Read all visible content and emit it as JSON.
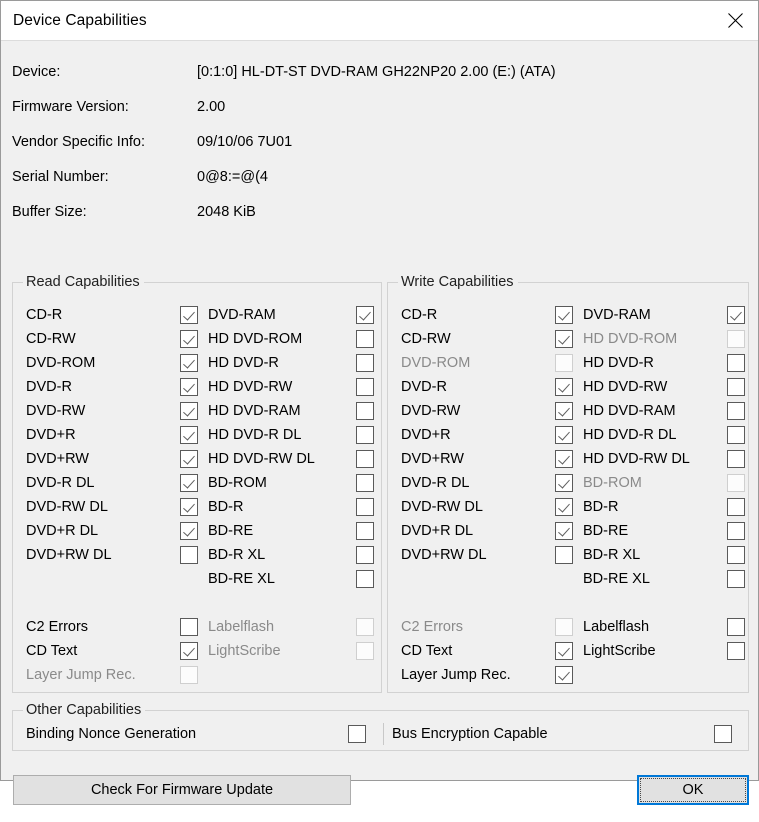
{
  "window": {
    "title": "Device Capabilities",
    "close_icon": "close-icon"
  },
  "info": {
    "rows": [
      {
        "label": "Device:",
        "value": "[0:1:0] HL-DT-ST DVD-RAM GH22NP20 2.00 (E:) (ATA)"
      },
      {
        "label": "Firmware Version:",
        "value": "2.00"
      },
      {
        "label": "Vendor Specific Info:",
        "value": "09/10/06 7U01"
      },
      {
        "label": "Serial Number:",
        "value": "0@8:=@(4"
      },
      {
        "label": "Buffer Size:",
        "value": "2048 KiB"
      }
    ]
  },
  "read": {
    "legend": "Read Capabilities",
    "left": [
      {
        "label": "CD-R",
        "checked": true,
        "enabled": true
      },
      {
        "label": "CD-RW",
        "checked": true,
        "enabled": true
      },
      {
        "label": "DVD-ROM",
        "checked": true,
        "enabled": true
      },
      {
        "label": "DVD-R",
        "checked": true,
        "enabled": true
      },
      {
        "label": "DVD-RW",
        "checked": true,
        "enabled": true
      },
      {
        "label": "DVD+R",
        "checked": true,
        "enabled": true
      },
      {
        "label": "DVD+RW",
        "checked": true,
        "enabled": true
      },
      {
        "label": "DVD-R DL",
        "checked": true,
        "enabled": true
      },
      {
        "label": "DVD-RW DL",
        "checked": true,
        "enabled": true
      },
      {
        "label": "DVD+R DL",
        "checked": true,
        "enabled": true
      },
      {
        "label": "DVD+RW DL",
        "checked": false,
        "enabled": true
      }
    ],
    "left_extra": [
      {
        "label": "C2 Errors",
        "checked": false,
        "enabled": true
      },
      {
        "label": "CD Text",
        "checked": true,
        "enabled": true
      },
      {
        "label": "Layer Jump Rec.",
        "checked": false,
        "enabled": false
      }
    ],
    "right": [
      {
        "label": "DVD-RAM",
        "checked": true,
        "enabled": true
      },
      {
        "label": "HD DVD-ROM",
        "checked": false,
        "enabled": true
      },
      {
        "label": "HD DVD-R",
        "checked": false,
        "enabled": true
      },
      {
        "label": "HD DVD-RW",
        "checked": false,
        "enabled": true
      },
      {
        "label": "HD DVD-RAM",
        "checked": false,
        "enabled": true
      },
      {
        "label": "HD DVD-R DL",
        "checked": false,
        "enabled": true
      },
      {
        "label": "HD DVD-RW DL",
        "checked": false,
        "enabled": true
      },
      {
        "label": "BD-ROM",
        "checked": false,
        "enabled": true
      },
      {
        "label": "BD-R",
        "checked": false,
        "enabled": true
      },
      {
        "label": "BD-RE",
        "checked": false,
        "enabled": true
      },
      {
        "label": "BD-R XL",
        "checked": false,
        "enabled": true
      },
      {
        "label": "BD-RE XL",
        "checked": false,
        "enabled": true
      }
    ],
    "right_extra": [
      {
        "label": "Labelflash",
        "checked": false,
        "enabled": false
      },
      {
        "label": "LightScribe",
        "checked": false,
        "enabled": false
      }
    ]
  },
  "write": {
    "legend": "Write Capabilities",
    "left": [
      {
        "label": "CD-R",
        "checked": true,
        "enabled": true
      },
      {
        "label": "CD-RW",
        "checked": true,
        "enabled": true
      },
      {
        "label": "DVD-ROM",
        "checked": false,
        "enabled": false
      },
      {
        "label": "DVD-R",
        "checked": true,
        "enabled": true
      },
      {
        "label": "DVD-RW",
        "checked": true,
        "enabled": true
      },
      {
        "label": "DVD+R",
        "checked": true,
        "enabled": true
      },
      {
        "label": "DVD+RW",
        "checked": true,
        "enabled": true
      },
      {
        "label": "DVD-R DL",
        "checked": true,
        "enabled": true
      },
      {
        "label": "DVD-RW DL",
        "checked": true,
        "enabled": true
      },
      {
        "label": "DVD+R DL",
        "checked": true,
        "enabled": true
      },
      {
        "label": "DVD+RW DL",
        "checked": false,
        "enabled": true
      }
    ],
    "left_extra": [
      {
        "label": "C2 Errors",
        "checked": false,
        "enabled": false
      },
      {
        "label": "CD Text",
        "checked": true,
        "enabled": true
      },
      {
        "label": "Layer Jump Rec.",
        "checked": true,
        "enabled": true
      }
    ],
    "right": [
      {
        "label": "DVD-RAM",
        "checked": true,
        "enabled": true
      },
      {
        "label": "HD DVD-ROM",
        "checked": false,
        "enabled": false
      },
      {
        "label": "HD DVD-R",
        "checked": false,
        "enabled": true
      },
      {
        "label": "HD DVD-RW",
        "checked": false,
        "enabled": true
      },
      {
        "label": "HD DVD-RAM",
        "checked": false,
        "enabled": true
      },
      {
        "label": "HD DVD-R DL",
        "checked": false,
        "enabled": true
      },
      {
        "label": "HD DVD-RW DL",
        "checked": false,
        "enabled": true
      },
      {
        "label": "BD-ROM",
        "checked": false,
        "enabled": false
      },
      {
        "label": "BD-R",
        "checked": false,
        "enabled": true
      },
      {
        "label": "BD-RE",
        "checked": false,
        "enabled": true
      },
      {
        "label": "BD-R XL",
        "checked": false,
        "enabled": true
      },
      {
        "label": "BD-RE XL",
        "checked": false,
        "enabled": true
      }
    ],
    "right_extra": [
      {
        "label": "Labelflash",
        "checked": false,
        "enabled": true
      },
      {
        "label": "LightScribe",
        "checked": false,
        "enabled": true
      }
    ]
  },
  "other": {
    "legend": "Other Capabilities",
    "left": {
      "label": "Binding Nonce Generation",
      "checked": false,
      "enabled": true
    },
    "right": {
      "label": "Bus Encryption Capable",
      "checked": false,
      "enabled": true
    }
  },
  "footer": {
    "firmware_button": "Check For Firmware Update",
    "ok_button": "OK"
  },
  "colors": {
    "window_bg": "#f0f0f0",
    "titlebar_bg": "#ffffff",
    "accent_focus": "#0078d7",
    "button_face": "#e1e1e1",
    "disabled_text": "#8a8a8a",
    "groupbox_border": "#d2d2d2"
  }
}
